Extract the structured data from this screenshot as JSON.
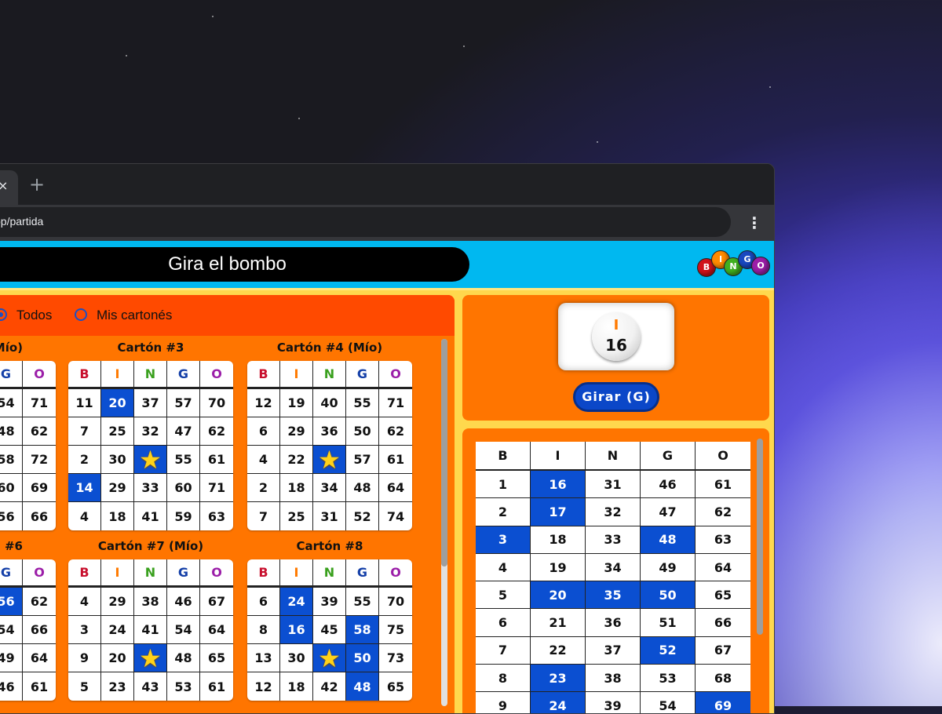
{
  "browser": {
    "tab_close_glyph": "×",
    "new_tab_glyph": "+",
    "url": "pp/partida",
    "menu_glyph": "⋮"
  },
  "header": {
    "title": "Gira el bombo",
    "logo_letters": [
      "B",
      "I",
      "N",
      "G",
      "O"
    ]
  },
  "filters": [
    {
      "label": "Todos",
      "selected": true
    },
    {
      "label": "Mis cartonés",
      "selected": false
    }
  ],
  "letters": [
    "B",
    "I",
    "N",
    "G",
    "O"
  ],
  "cards": [
    {
      "title": "(Mío)",
      "rows": [
        [
          "",
          "",
          "",
          "54",
          "71"
        ],
        [
          "",
          "",
          "",
          "48",
          "62"
        ],
        [
          "",
          "",
          "",
          "58",
          "72"
        ],
        [
          "",
          "",
          "",
          "60",
          "69"
        ],
        [
          "",
          "",
          "",
          "56",
          "66"
        ]
      ],
      "marked": [
        [
          2,
          2
        ]
      ]
    },
    {
      "title": "Cartón #3",
      "rows": [
        [
          "11",
          "20",
          "37",
          "57",
          "70"
        ],
        [
          "7",
          "25",
          "32",
          "47",
          "62"
        ],
        [
          "2",
          "30",
          "★",
          "55",
          "61"
        ],
        [
          "14",
          "29",
          "33",
          "60",
          "71"
        ],
        [
          "4",
          "18",
          "41",
          "59",
          "63"
        ]
      ],
      "marked": [
        [
          0,
          1
        ],
        [
          2,
          2
        ],
        [
          3,
          0
        ]
      ]
    },
    {
      "title": "Cartón #4 (Mío)",
      "rows": [
        [
          "12",
          "19",
          "40",
          "55",
          "71"
        ],
        [
          "6",
          "29",
          "36",
          "50",
          "62"
        ],
        [
          "4",
          "22",
          "★",
          "57",
          "61"
        ],
        [
          "2",
          "18",
          "34",
          "48",
          "64"
        ],
        [
          "7",
          "25",
          "31",
          "52",
          "74"
        ]
      ],
      "marked": [
        [
          2,
          2
        ]
      ]
    },
    {
      "title": "#6",
      "rows": [
        [
          "",
          "",
          "",
          "56",
          "62"
        ],
        [
          "",
          "",
          "",
          "54",
          "66"
        ],
        [
          "",
          "",
          "",
          "49",
          "64"
        ],
        [
          "",
          "",
          "",
          "46",
          "61"
        ]
      ],
      "marked": [
        [
          0,
          3
        ]
      ]
    },
    {
      "title": "Cartón #7 (Mío)",
      "rows": [
        [
          "4",
          "29",
          "38",
          "46",
          "67"
        ],
        [
          "3",
          "24",
          "41",
          "54",
          "64"
        ],
        [
          "9",
          "20",
          "★",
          "48",
          "65"
        ],
        [
          "5",
          "23",
          "43",
          "53",
          "61"
        ]
      ],
      "marked": [
        [
          2,
          2
        ]
      ]
    },
    {
      "title": "Cartón #8",
      "rows": [
        [
          "6",
          "24",
          "39",
          "55",
          "70"
        ],
        [
          "8",
          "16",
          "45",
          "58",
          "75"
        ],
        [
          "13",
          "30",
          "★",
          "50",
          "73"
        ],
        [
          "12",
          "18",
          "42",
          "48",
          "65"
        ]
      ],
      "marked": [
        [
          0,
          1
        ],
        [
          1,
          1
        ],
        [
          1,
          3
        ],
        [
          2,
          2
        ],
        [
          2,
          3
        ],
        [
          3,
          3
        ]
      ]
    }
  ],
  "current_ball": {
    "letter": "I",
    "number": "16"
  },
  "spin_button": "Girar (G)",
  "board": {
    "rows": [
      [
        "1",
        "16",
        "31",
        "46",
        "61"
      ],
      [
        "2",
        "17",
        "32",
        "47",
        "62"
      ],
      [
        "3",
        "18",
        "33",
        "48",
        "63"
      ],
      [
        "4",
        "19",
        "34",
        "49",
        "64"
      ],
      [
        "5",
        "20",
        "35",
        "50",
        "65"
      ],
      [
        "6",
        "21",
        "36",
        "51",
        "66"
      ],
      [
        "7",
        "22",
        "37",
        "52",
        "67"
      ],
      [
        "8",
        "23",
        "38",
        "53",
        "68"
      ],
      [
        "9",
        "24",
        "39",
        "54",
        "69"
      ]
    ],
    "called": [
      "16",
      "17",
      "3",
      "48",
      "20",
      "35",
      "50",
      "52",
      "23",
      "24",
      "69"
    ]
  },
  "colors": {
    "accent": "#0b4fd1",
    "panel": "#ff7500",
    "header": "#00b8f0"
  }
}
